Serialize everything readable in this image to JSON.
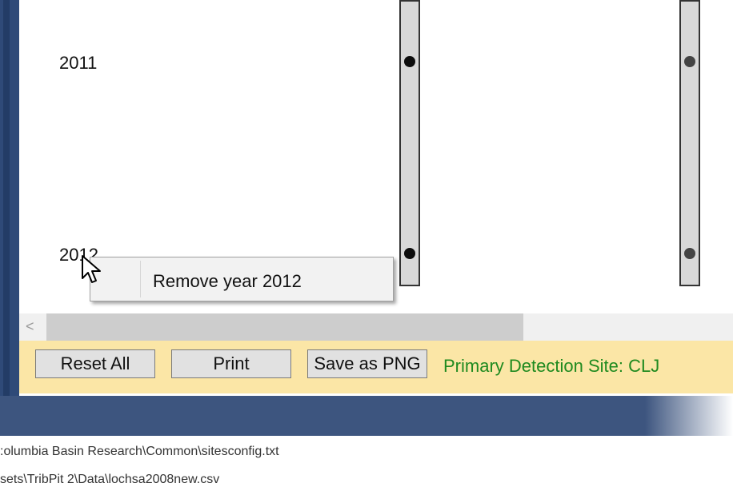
{
  "chart": {
    "years": [
      "2011",
      "2012"
    ]
  },
  "context_menu": {
    "item_label": "Remove year 2012"
  },
  "scrollbar": {
    "left_arrow": "<"
  },
  "toolbar": {
    "reset_label": "Reset All",
    "print_label": "Print",
    "save_label": "Save as PNG",
    "status_text": "Primary Detection Site: CLJ"
  },
  "footer": {
    "line1": ":olumbia Basin Research\\Common\\sitesconfig.txt",
    "line2": "sets\\TribPit 2\\Data\\lochsa2008new.csv"
  },
  "colors": {
    "toolbar_bg": "#fbe6a6",
    "status_text": "#1f8a1f",
    "frame": "#2f4a78"
  }
}
